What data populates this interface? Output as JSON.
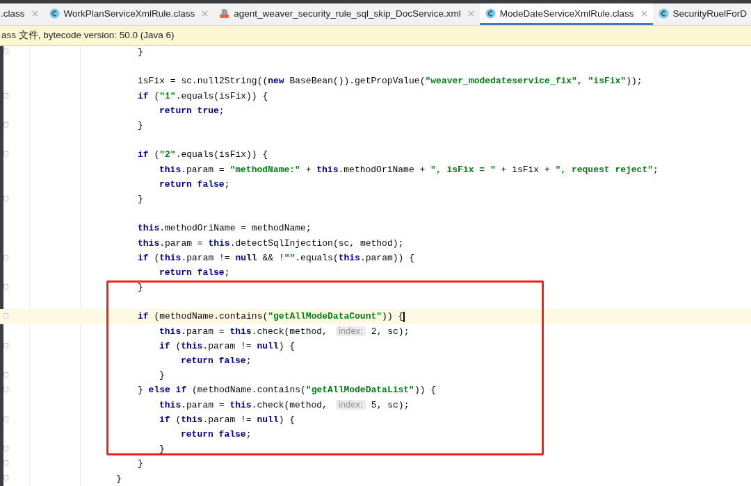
{
  "tabs": [
    {
      "label": ".class",
      "kind": "plain",
      "selected": false
    },
    {
      "label": "WorkPlanServiceXmlRule.class",
      "kind": "class",
      "selected": false
    },
    {
      "label": "agent_weaver_security_rule_sql_skip_DocService.xml",
      "kind": "xml",
      "selected": false
    },
    {
      "label": "ModeDateServiceXmlRule.class",
      "kind": "class",
      "selected": true
    },
    {
      "label": "SecurityRuelForD",
      "kind": "class",
      "selected": false
    }
  ],
  "info_bar": {
    "text": "ass 文件, bytecode version: 50.0 (Java 6)"
  },
  "code": {
    "lines": [
      {
        "kind": "code",
        "fold": true,
        "tokens": [
          {
            "kind": "plain",
            "text": "}"
          }
        ]
      },
      {
        "kind": "blank"
      },
      {
        "kind": "code",
        "fold": false,
        "tokens": [
          {
            "kind": "plain",
            "text": "isFix = sc.null2String(("
          },
          {
            "kind": "kw",
            "text": "new"
          },
          {
            "kind": "plain",
            "text": " BaseBean()).getPropValue("
          },
          {
            "kind": "str",
            "text": "\"weaver_modedateservice_fix\""
          },
          {
            "kind": "plain",
            "text": ", "
          },
          {
            "kind": "str",
            "text": "\"isFix\""
          },
          {
            "kind": "plain",
            "text": "));"
          }
        ]
      },
      {
        "kind": "code",
        "fold": true,
        "tokens": [
          {
            "kind": "kw",
            "text": "if"
          },
          {
            "kind": "plain",
            "text": " ("
          },
          {
            "kind": "str",
            "text": "\"1\""
          },
          {
            "kind": "plain",
            "text": ".equals(isFix)) {"
          }
        ],
        "children": [
          {
            "kind": "code",
            "fold": false,
            "tokens": [
              {
                "kind": "kw",
                "text": "return true"
              },
              {
                "kind": "plain",
                "text": ";"
              }
            ]
          }
        ]
      },
      {
        "kind": "code",
        "fold": true,
        "tokens": [
          {
            "kind": "plain",
            "text": "}"
          }
        ]
      },
      {
        "kind": "blank"
      },
      {
        "kind": "code",
        "fold": true,
        "tokens": [
          {
            "kind": "kw",
            "text": "if"
          },
          {
            "kind": "plain",
            "text": " ("
          },
          {
            "kind": "str",
            "text": "\"2\""
          },
          {
            "kind": "plain",
            "text": ".equals(isFix)) {"
          }
        ],
        "children": [
          {
            "kind": "code",
            "fold": false,
            "tokens": [
              {
                "kind": "kw",
                "text": "this"
              },
              {
                "kind": "plain",
                "text": ".param = "
              },
              {
                "kind": "str",
                "text": "\"methodName:\""
              },
              {
                "kind": "plain",
                "text": " + "
              },
              {
                "kind": "kw",
                "text": "this"
              },
              {
                "kind": "plain",
                "text": ".methodOriName + "
              },
              {
                "kind": "str",
                "text": "\", isFix = \""
              },
              {
                "kind": "plain",
                "text": " + isFix + "
              },
              {
                "kind": "str",
                "text": "\", request reject\""
              },
              {
                "kind": "plain",
                "text": ";"
              }
            ]
          },
          {
            "kind": "code",
            "fold": false,
            "tokens": [
              {
                "kind": "kw",
                "text": "return false"
              },
              {
                "kind": "plain",
                "text": ";"
              }
            ]
          }
        ]
      },
      {
        "kind": "code",
        "fold": true,
        "tokens": [
          {
            "kind": "plain",
            "text": "}"
          }
        ]
      },
      {
        "kind": "blank"
      },
      {
        "kind": "code",
        "fold": false,
        "tokens": [
          {
            "kind": "kw",
            "text": "this"
          },
          {
            "kind": "plain",
            "text": ".methodOriName = methodName;"
          }
        ]
      },
      {
        "kind": "code",
        "fold": false,
        "tokens": [
          {
            "kind": "kw",
            "text": "this"
          },
          {
            "kind": "plain",
            "text": ".param = "
          },
          {
            "kind": "kw",
            "text": "this"
          },
          {
            "kind": "plain",
            "text": ".detectSqlInjection(sc, method);"
          }
        ]
      },
      {
        "kind": "code",
        "fold": true,
        "tokens": [
          {
            "kind": "kw",
            "text": "if"
          },
          {
            "kind": "plain",
            "text": " ("
          },
          {
            "kind": "kw",
            "text": "this"
          },
          {
            "kind": "plain",
            "text": ".param != "
          },
          {
            "kind": "kw",
            "text": "null"
          },
          {
            "kind": "plain",
            "text": " && !"
          },
          {
            "kind": "str",
            "text": "\"\""
          },
          {
            "kind": "plain",
            "text": ".equals("
          },
          {
            "kind": "kw",
            "text": "this"
          },
          {
            "kind": "plain",
            "text": ".param)) {"
          }
        ],
        "children": [
          {
            "kind": "code",
            "fold": false,
            "tokens": [
              {
                "kind": "kw",
                "text": "return false"
              },
              {
                "kind": "plain",
                "text": ";"
              }
            ]
          }
        ]
      },
      {
        "kind": "code",
        "fold": true,
        "tokens": [
          {
            "kind": "plain",
            "text": "}"
          }
        ]
      },
      {
        "kind": "blank"
      },
      {
        "kind": "code",
        "fold": true,
        "current": true,
        "tokens": [
          {
            "kind": "kw",
            "text": "if"
          },
          {
            "kind": "plain",
            "text": " (methodName.contains("
          },
          {
            "kind": "str",
            "text": "\"getAllModeDataCount\""
          },
          {
            "kind": "plain",
            "text": ")) {"
          }
        ],
        "children": [
          {
            "kind": "code",
            "fold": false,
            "tokens": [
              {
                "kind": "kw",
                "text": "this"
              },
              {
                "kind": "plain",
                "text": ".param = "
              },
              {
                "kind": "kw",
                "text": "this"
              },
              {
                "kind": "plain",
                "text": ".check(method, "
              },
              {
                "kind": "hint",
                "text": "index:"
              },
              {
                "kind": "plain",
                "text": " 2, sc);"
              }
            ]
          },
          {
            "kind": "code",
            "fold": true,
            "tokens": [
              {
                "kind": "kw",
                "text": "if"
              },
              {
                "kind": "plain",
                "text": " ("
              },
              {
                "kind": "kw",
                "text": "this"
              },
              {
                "kind": "plain",
                "text": ".param != "
              },
              {
                "kind": "kw",
                "text": "null"
              },
              {
                "kind": "plain",
                "text": ") {"
              }
            ],
            "children": [
              {
                "kind": "code",
                "fold": false,
                "tokens": [
                  {
                    "kind": "kw",
                    "text": "return false"
                  },
                  {
                    "kind": "plain",
                    "text": ";"
                  }
                ]
              }
            ]
          },
          {
            "kind": "code",
            "fold": true,
            "tokens": [
              {
                "kind": "plain",
                "text": "}"
              }
            ]
          }
        ]
      },
      {
        "kind": "code",
        "fold": true,
        "tokens": [
          {
            "kind": "plain",
            "text": "} "
          },
          {
            "kind": "kw",
            "text": "else if"
          },
          {
            "kind": "plain",
            "text": " (methodName.contains("
          },
          {
            "kind": "str",
            "text": "\"getAllModeDataList\""
          },
          {
            "kind": "plain",
            "text": ")) {"
          }
        ],
        "children": [
          {
            "kind": "code",
            "fold": false,
            "tokens": [
              {
                "kind": "kw",
                "text": "this"
              },
              {
                "kind": "plain",
                "text": ".param = "
              },
              {
                "kind": "kw",
                "text": "this"
              },
              {
                "kind": "plain",
                "text": ".check(method, "
              },
              {
                "kind": "hint",
                "text": "index:"
              },
              {
                "kind": "plain",
                "text": " 5, sc);"
              }
            ]
          },
          {
            "kind": "code",
            "fold": true,
            "tokens": [
              {
                "kind": "kw",
                "text": "if"
              },
              {
                "kind": "plain",
                "text": " ("
              },
              {
                "kind": "kw",
                "text": "this"
              },
              {
                "kind": "plain",
                "text": ".param != "
              },
              {
                "kind": "kw",
                "text": "null"
              },
              {
                "kind": "plain",
                "text": ") {"
              }
            ],
            "children": [
              {
                "kind": "code",
                "fold": false,
                "tokens": [
                  {
                    "kind": "kw",
                    "text": "return false"
                  },
                  {
                    "kind": "plain",
                    "text": ";"
                  }
                ]
              }
            ]
          },
          {
            "kind": "code",
            "fold": true,
            "tokens": [
              {
                "kind": "plain",
                "text": "}"
              }
            ]
          }
        ]
      },
      {
        "kind": "code",
        "fold": true,
        "tokens": [
          {
            "kind": "plain",
            "text": "}"
          }
        ]
      }
    ],
    "trailing_lines": [
      {
        "kind": "code",
        "fold": true,
        "tokens": [
          {
            "kind": "plain",
            "text": "}"
          }
        ]
      }
    ]
  }
}
